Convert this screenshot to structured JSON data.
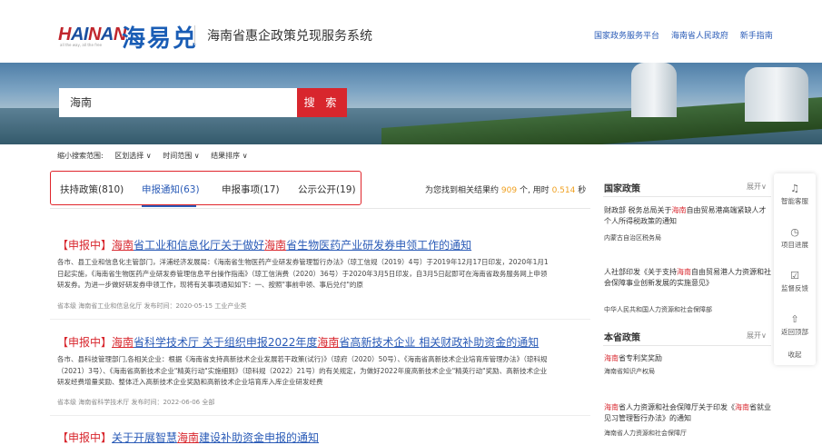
{
  "header": {
    "logo_latin": "HAINAN",
    "logo_tagline": "all the way, all the free",
    "logo_cn": "海易兑",
    "system_title": "海南省惠企政策兑现服务系统",
    "links": [
      "国家政务服务平台",
      "海南省人民政府",
      "新手指南"
    ]
  },
  "search": {
    "value": "海南",
    "button": "搜 索"
  },
  "filters": {
    "label": "缩小搜索范围:",
    "items": [
      "区划选择 ∨",
      "时间范围 ∨",
      "结果排序 ∨"
    ]
  },
  "tabs": [
    {
      "label": "扶持政策(810)"
    },
    {
      "label": "申报通知(63)"
    },
    {
      "label": "申报事项(17)"
    },
    {
      "label": "公示公开(19)"
    }
  ],
  "result_info": {
    "prefix": "为您找到相关结果约",
    "count": "909",
    "mid": "个, 用时",
    "time": "0.514",
    "suffix": "秒"
  },
  "results": [
    {
      "tag": "【申报中】",
      "title_parts": [
        "海南",
        "省工业和信息化厅关于做好",
        "海南",
        "省生物医药产业研发券申领工作的通知"
      ],
      "desc": "各市、县工业和信息化主管部门，洋浦经济发展局：《海南省生物医药产业研发券管理暂行办法》（琼工信规（2019）4号）于2019年12月17日印发，2020年1月1日起实施，《海南省生物医药产业研发券管理信息平台操作指南》（琼工信消费（2020）36号）于2020年3月5日印发，自3月5日起即可在海南省政务服务网上申领研发券。为进一步做好研发券申领工作，现将有关事项通知如下：一、按照\"事前申领、事后兑付\"的原",
      "meta": "省本级   海南省工业和信息化厅   发布时间：2020-05-15   工业产业类"
    },
    {
      "tag": "【申报中】",
      "title_parts": [
        "海南",
        "省科学技术厅 关于组织申报2022年度",
        "海南",
        "省高新技术企业 相关财政补助资金的通知"
      ],
      "desc": "各市、县科技管理部门,各相关企业：根据《海南省支持高新技术企业发展若干政策(试行)》（琼府（2020）50号）、《海南省高新技术企业培育库管理办法》（琼科规（2021）3号）、《海南省高新技术企业\"精英行动\"实施细则》（琼科规（2022）21号）的有关规定，为做好2022年度高新技术企业\"精英行动\"奖励、高新技术企业研发经费增量奖励、整体迁入高新技术企业奖励和高新技术企业培育库入库企业研发经费",
      "meta": "省本级   海南省科学技术厅   发布时间：2022-06-06   全部"
    },
    {
      "tag": "【申报中】",
      "title_parts": [
        "关于开展智慧",
        "海南",
        "建设补助资金申报的通知"
      ]
    }
  ],
  "sidebar": {
    "national": {
      "title": "国家政策",
      "more": "展开∨",
      "items": [
        {
          "text_parts": [
            "财政部 税务总局关于",
            "海南",
            "自由贸易港高端紧缺人才个人所得税政策的通知"
          ],
          "source": "内蒙古自治区税务局"
        },
        {
          "text_parts": [
            "人社部印发《关于支持",
            "海南",
            "自由贸易港人力资源和社会保障事业创新发展的实施意见》"
          ],
          "source": "中华人民共和国人力资源和社会保障部"
        }
      ]
    },
    "provincial": {
      "title": "本省政策",
      "more": "展开∨",
      "items": [
        {
          "text_parts": [
            "海南",
            "省专利奖奖励"
          ],
          "source": "海南省知识产权局"
        },
        {
          "text_parts": [
            "海南",
            "省人力资源和社会保障厅关于印发《",
            "海南",
            "省就业见习管理暂行办法》的通知"
          ],
          "source": "海南省人力资源和社会保障厅"
        }
      ]
    }
  },
  "float_bar": {
    "items": [
      {
        "icon": "headset-icon",
        "glyph": "♫",
        "label": "智能客服"
      },
      {
        "icon": "clock-icon",
        "glyph": "◷",
        "label": "项目进展"
      },
      {
        "icon": "feedback-icon",
        "glyph": "☑",
        "label": "监督反馈"
      },
      {
        "icon": "arrow-up-icon",
        "glyph": "⇧",
        "label": "返回顶部"
      }
    ],
    "collapse": "收起"
  },
  "colors": {
    "brand_blue": "#2a5bb7",
    "accent_red": "#d8262d",
    "highlight_orange": "#f0a020"
  }
}
